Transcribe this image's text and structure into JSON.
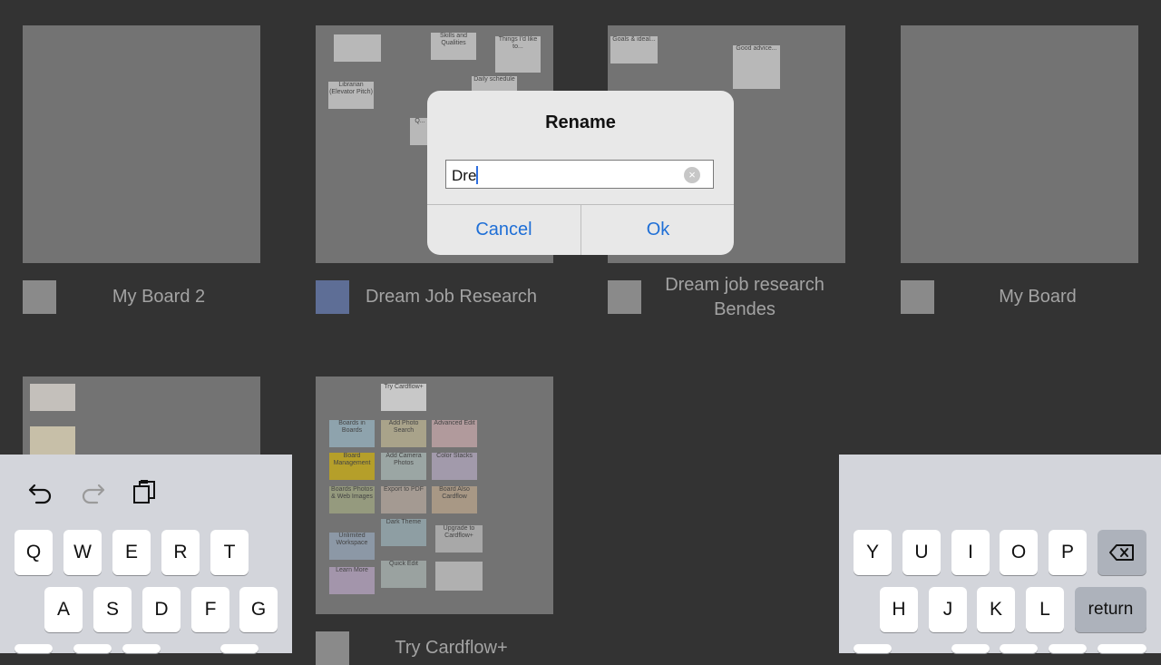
{
  "boards": [
    {
      "title": "My Board 2",
      "swatch_color": "#8a8a8a"
    },
    {
      "title": "Dream Job Research",
      "swatch_color": "#5e6e96"
    },
    {
      "title_lines": [
        "Dream job research",
        "Bendes"
      ],
      "swatch_color": "#8a8a8a"
    },
    {
      "title": "My Board",
      "swatch_color": "#8a8a8a"
    },
    {
      "title": "",
      "swatch_color": "#8a8a8a"
    },
    {
      "title": "Try Cardflow+",
      "swatch_color": "#8a8a8a"
    }
  ],
  "thumb_cards": {
    "dream_job": [
      "Skills and Qualities",
      "Things I'd like to...",
      "Librarian (Elevator Pitch)",
      "Daily schedule",
      "Q..."
    ],
    "bendes": [
      "Goals & ideal...",
      "Good advice..."
    ],
    "try_cardflow": [
      "Try Cardflow+",
      "Boards in Boards",
      "Add Photo Search",
      "Advanced Edit",
      "Board Management",
      "Add Camera Photos",
      "Color Stacks",
      "Boards Photos & Web Images",
      "Export to PDF",
      "Board Also Cardflow",
      "Dark Theme",
      "Unlimited Workspace",
      "Upgrade to Cardflow+",
      "Quick Edit",
      "Learn More"
    ]
  },
  "dialog": {
    "title": "Rename",
    "input_value": "Dre",
    "clear_icon": "clear-circle-icon",
    "cancel_label": "Cancel",
    "ok_label": "Ok"
  },
  "keyboard": {
    "toolbar_icons": [
      "undo-icon",
      "redo-icon",
      "paste-icon"
    ],
    "left_row1": [
      "Q",
      "W",
      "E",
      "R",
      "T"
    ],
    "left_row2": [
      "A",
      "S",
      "D",
      "F",
      "G"
    ],
    "right_row1": [
      "Y",
      "U",
      "I",
      "O",
      "P"
    ],
    "right_row2": [
      "H",
      "J",
      "K",
      "L"
    ],
    "return_label": "return",
    "backspace_icon": "backspace-icon"
  },
  "colors": {
    "background": "#333333",
    "accent": "#1f6fd6",
    "keyboard_bg": "#d3d5db"
  }
}
